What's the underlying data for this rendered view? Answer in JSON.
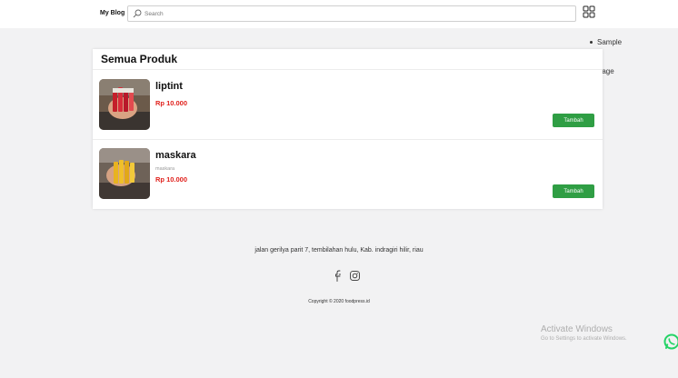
{
  "header": {
    "brand": "My Blog",
    "search_placeholder": "Search"
  },
  "side_menu": {
    "items": [
      "Sample",
      "Page"
    ]
  },
  "main": {
    "title": "Semua Produk",
    "products": [
      {
        "name": "liptint",
        "description": "",
        "price": "Rp 10.000",
        "button": "Tambah"
      },
      {
        "name": "maskara",
        "description": "maskara",
        "price": "Rp 10.000",
        "button": "Tambah"
      }
    ]
  },
  "footer": {
    "address": "jalan gerilya parit 7, tembilahan hulu, Kab. indragiri hilir, riau",
    "copyright": "Copyright © 2020 foodpress.id"
  },
  "watermark": {
    "title": "Activate Windows",
    "subtitle": "Go to Settings to activate Windows."
  },
  "colors": {
    "accent_green": "#2f9e44",
    "price_red": "#e0211c",
    "whatsapp_green": "#25d366"
  },
  "icons": [
    "search-icon",
    "grid-icon",
    "facebook-icon",
    "instagram-icon",
    "whatsapp-icon"
  ]
}
